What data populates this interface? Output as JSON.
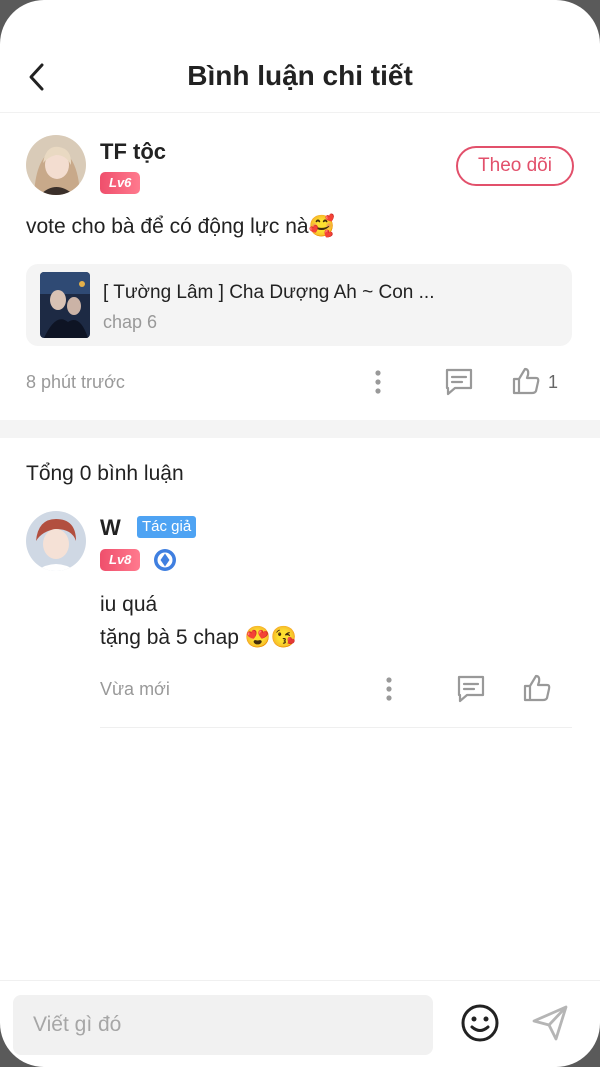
{
  "header": {
    "title": "Bình luận chi tiết",
    "back_icon": "chevron-left-icon"
  },
  "post": {
    "user_name": "TF tộc",
    "level": "Lv6",
    "follow_label": "Theo dõi",
    "text": "vote cho bà để có động lực nà🥰",
    "linked_story": {
      "title": "[ Tường Lâm ] Cha Dượng Ah ~ Con ...",
      "chapter": "chap 6"
    },
    "time": "8 phút trước",
    "like_count": "1"
  },
  "comments_section": {
    "total_label": "Tổng 0 bình luận",
    "reply": {
      "user_name": "W",
      "author_tag": "Tác giả",
      "level": "Lv8",
      "line1": "iu quá",
      "line2": "tặng bà 5 chap 😍😘",
      "time": "Vừa mới"
    }
  },
  "composer": {
    "placeholder": "Viết gì đó"
  },
  "colors": {
    "accent": "#e2506b",
    "author_tag": "#4ea3f3",
    "muted": "#999999"
  }
}
